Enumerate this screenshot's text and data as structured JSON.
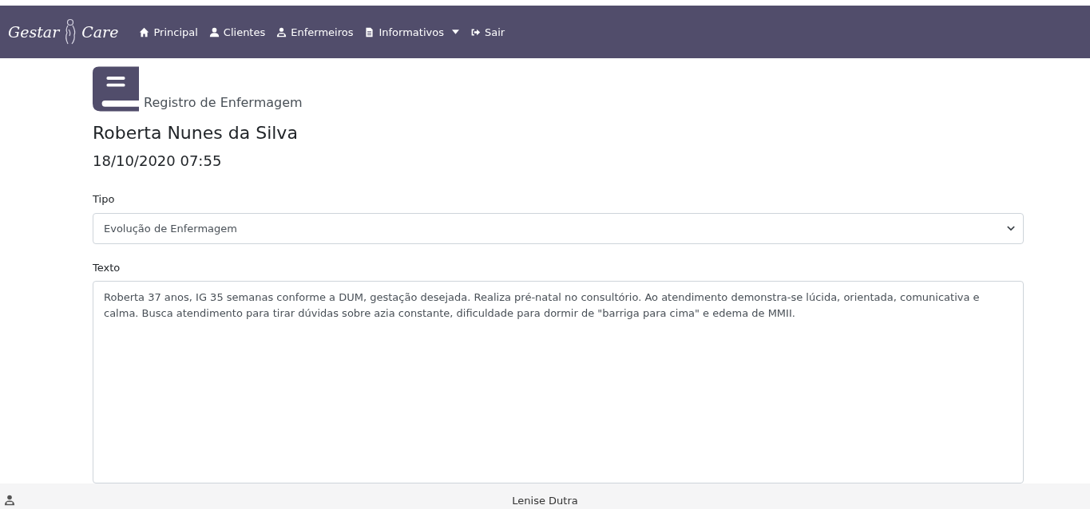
{
  "navbar": {
    "brand": {
      "word_1": "Gestar",
      "word_2": "Care"
    },
    "items": [
      {
        "kind": "home",
        "label": "Principal"
      },
      {
        "kind": "user",
        "label": "Clientes"
      },
      {
        "kind": "nurse",
        "label": "Enfermeiros"
      },
      {
        "kind": "document",
        "label": "Informativos",
        "dropdown": true
      },
      {
        "kind": "logout",
        "label": "Sair"
      }
    ]
  },
  "header": {
    "subtitle": "Registro de Enfermagem",
    "patient": "Roberta Nunes da Silva",
    "datetime": "18/10/2020 07:55"
  },
  "form": {
    "type_label": "Tipo",
    "type_value": "Evolução de Enfermagem",
    "text_label": "Texto",
    "text_value": "Roberta 37 anos, IG 35 semanas conforme a DUM, gestação desejada. Realiza pré-natal no consultório. Ao atendimento demonstra-se lúcida, orientada, comunicativa e calma. Busca atendimento para tirar dúvidas sobre azia constante, dificuldade para dormir de \"barriga para cima\" e edema de MMII."
  },
  "footer": {
    "user": "Lenise Dutra"
  }
}
